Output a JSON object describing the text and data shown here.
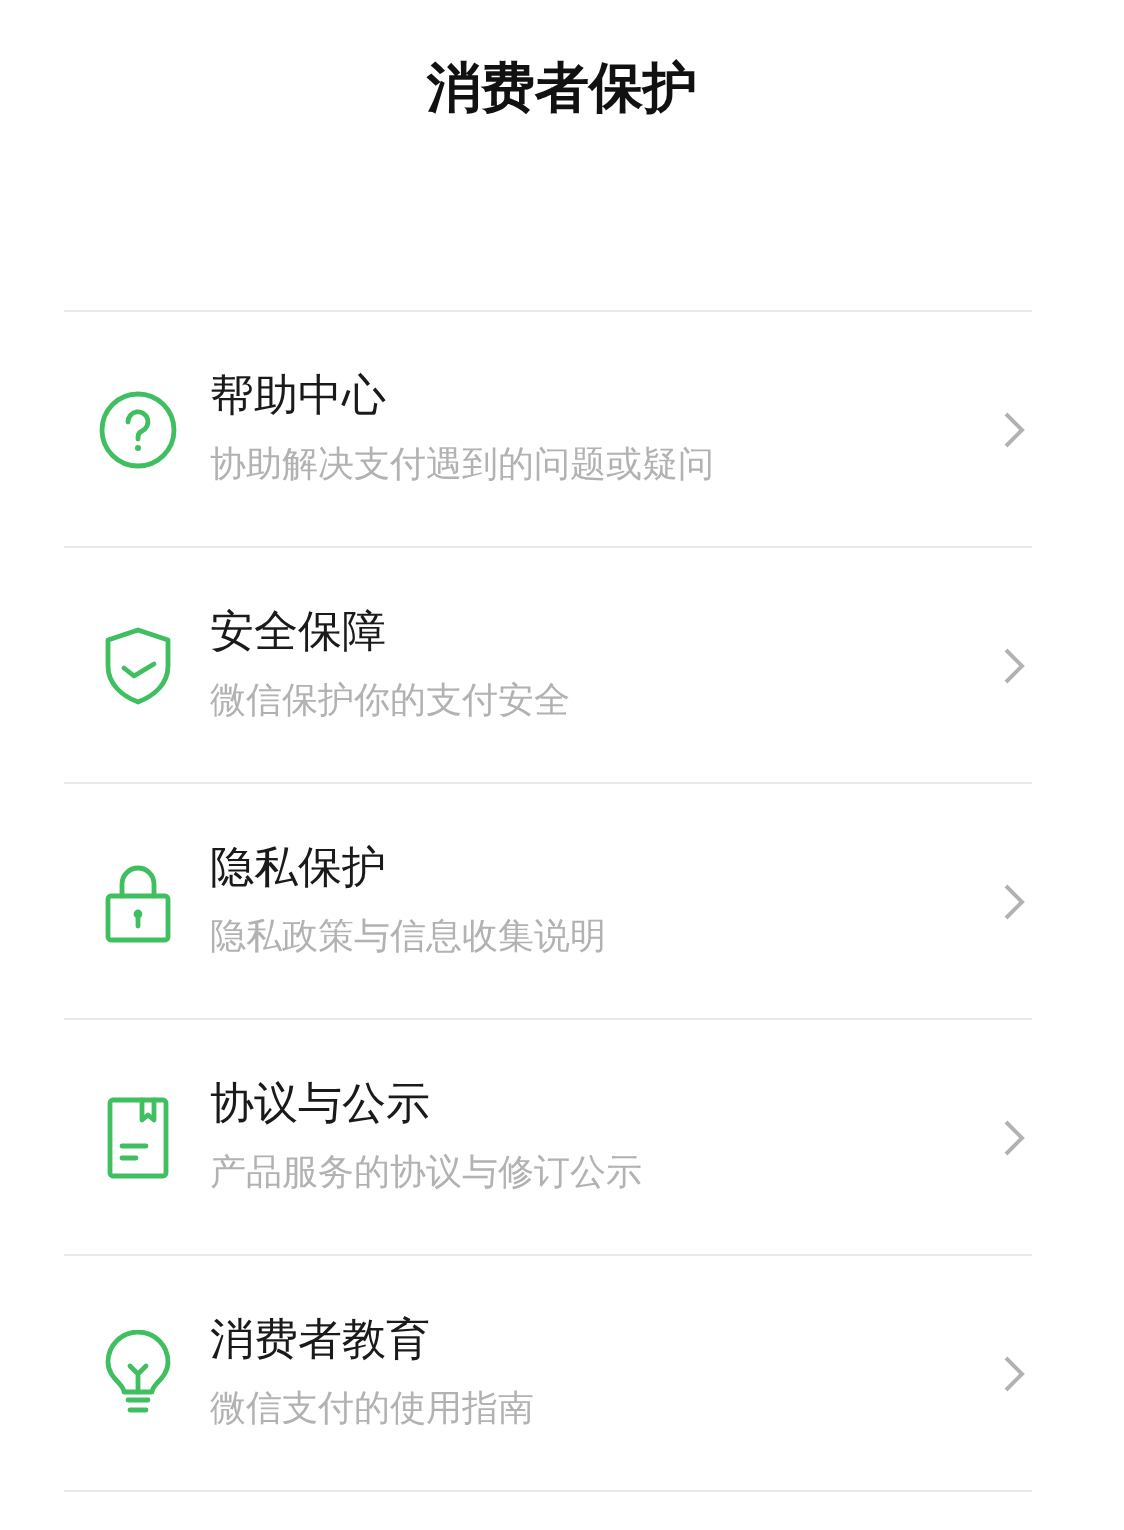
{
  "header": {
    "title": "消费者保护"
  },
  "items": [
    {
      "kind": "help",
      "title": "帮助中心",
      "subtitle": "协助解决支付遇到的问题或疑问"
    },
    {
      "kind": "shield",
      "title": "安全保障",
      "subtitle": "微信保护你的支付安全"
    },
    {
      "kind": "lock",
      "title": "隐私保护",
      "subtitle": "隐私政策与信息收集说明"
    },
    {
      "kind": "document",
      "title": "协议与公示",
      "subtitle": "产品服务的协议与修订公示"
    },
    {
      "kind": "bulb",
      "title": "消费者教育",
      "subtitle": "微信支付的使用指南"
    }
  ]
}
